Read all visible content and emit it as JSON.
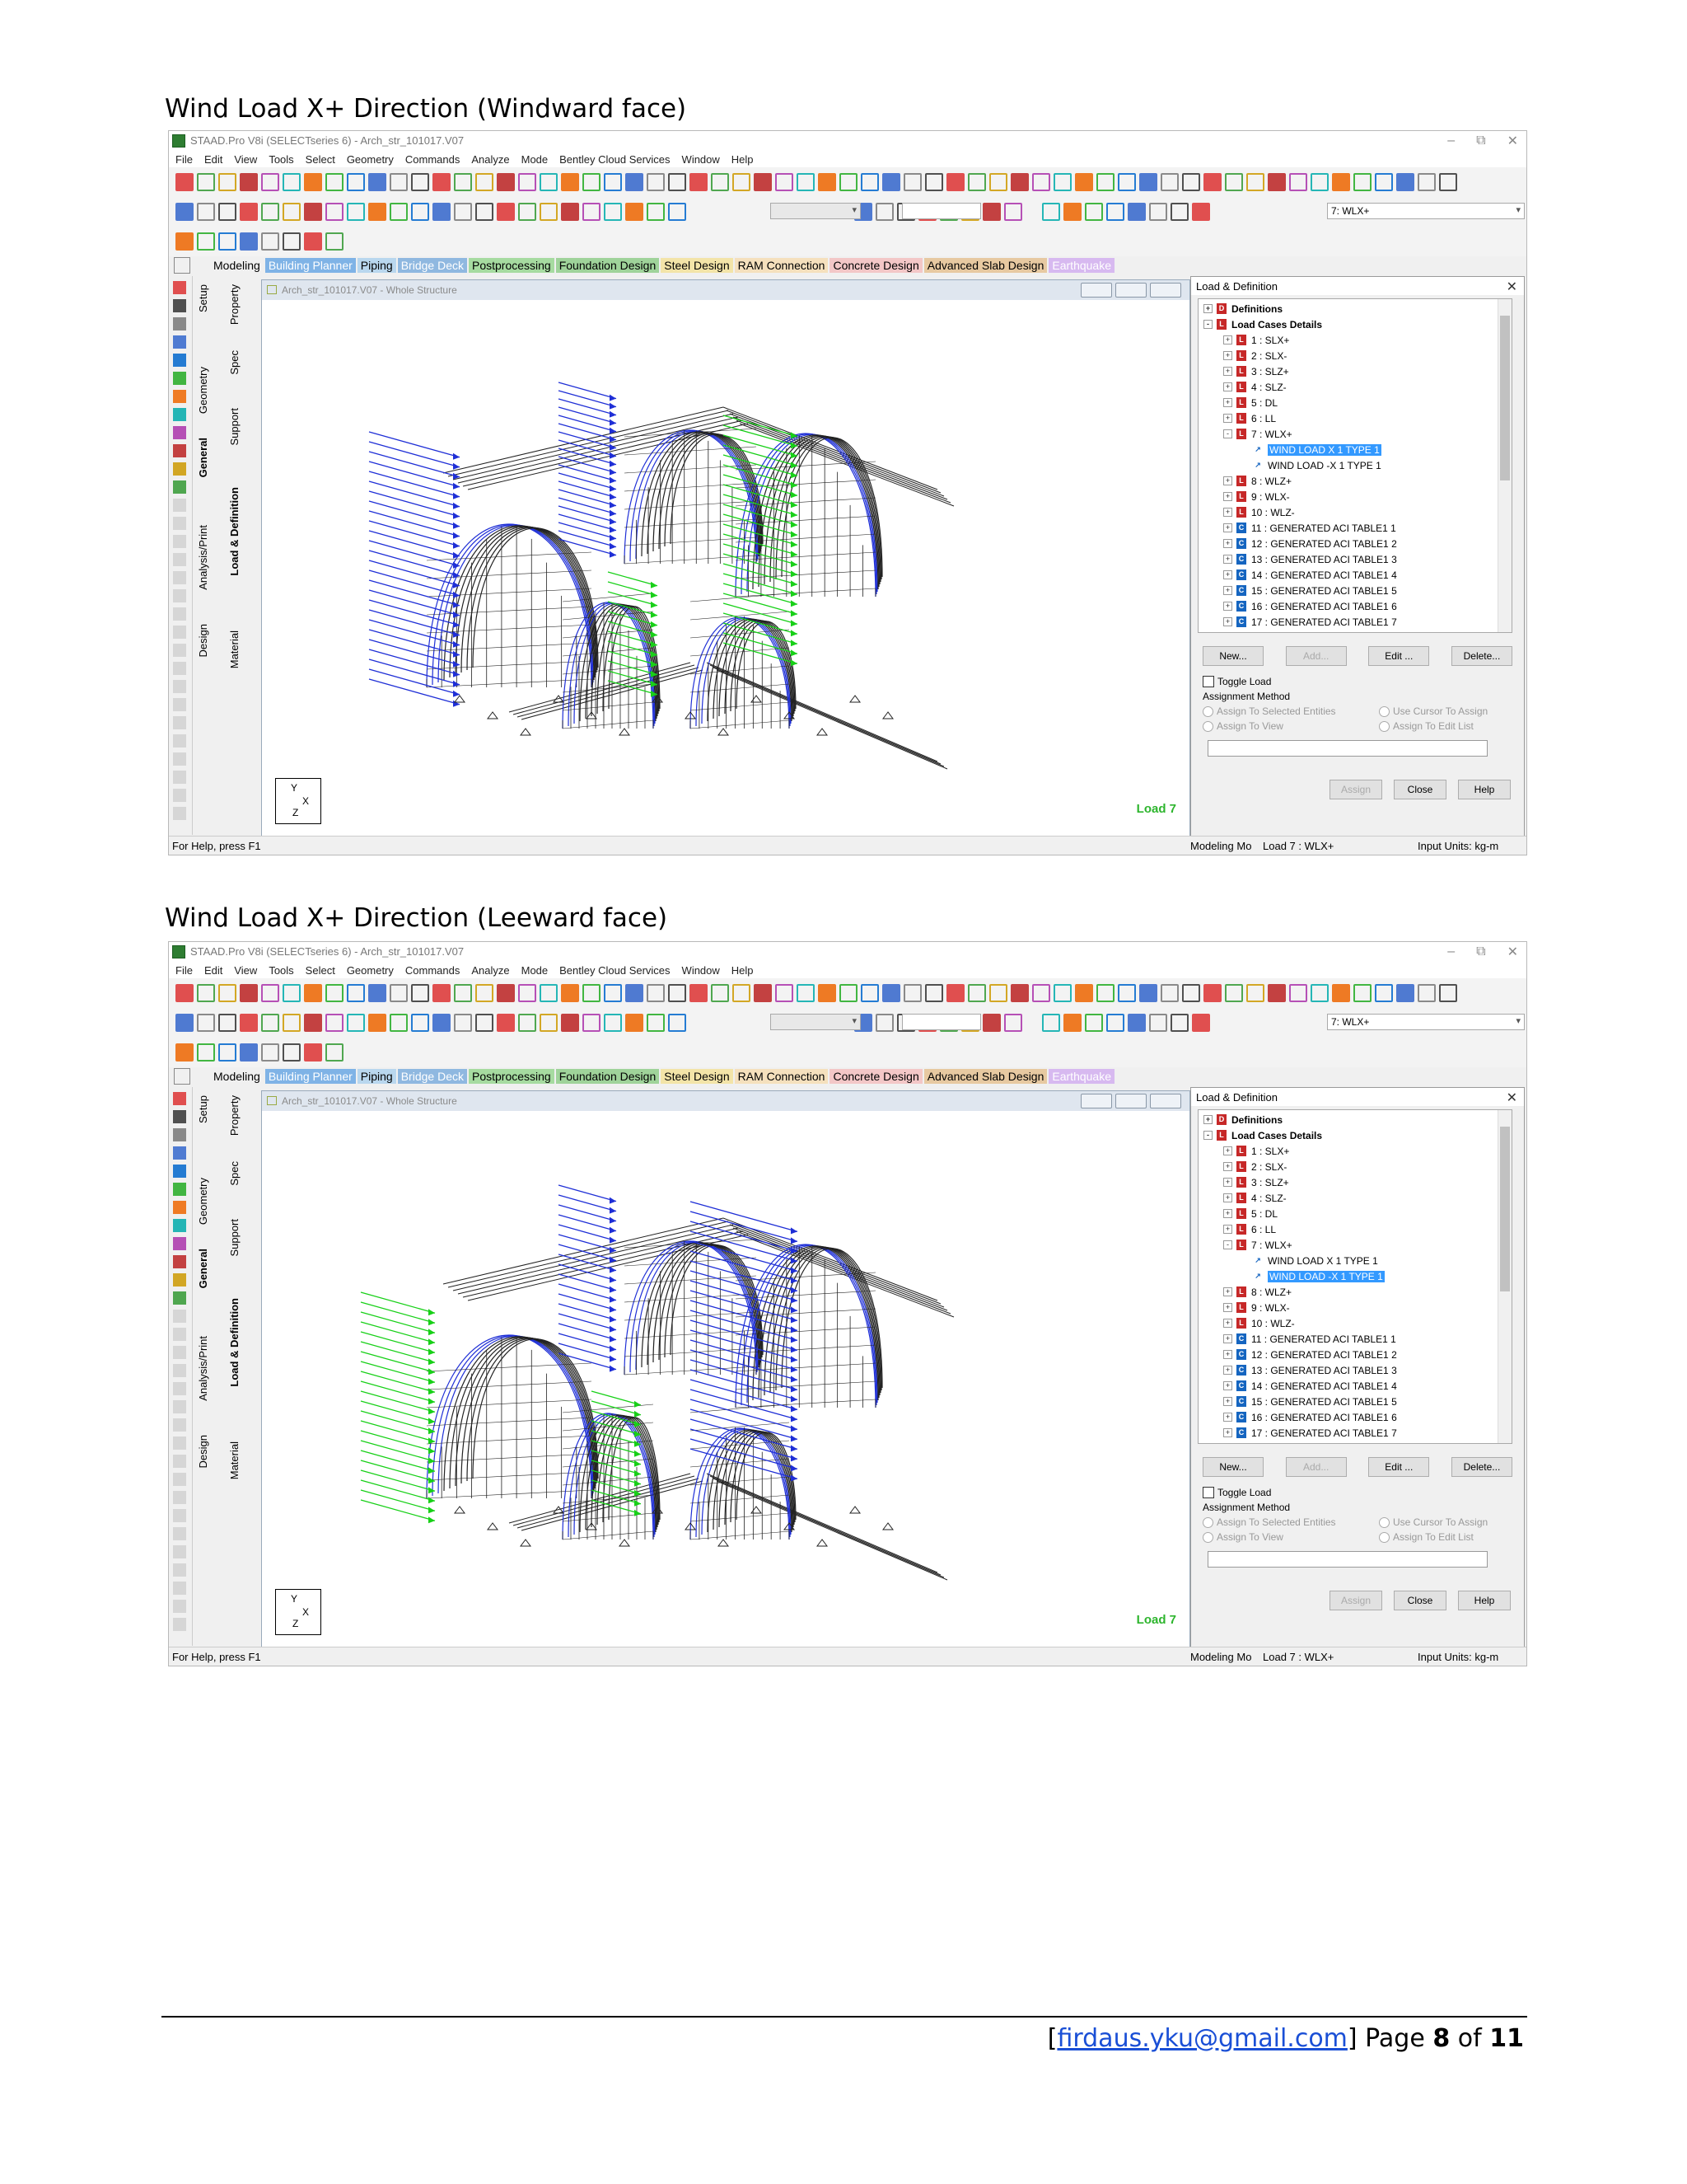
{
  "sections": [
    {
      "heading": "Wind Load X+ Direction (Windward face)",
      "app": {
        "title": "STAAD.Pro V8i (SELECTseries 6) - Arch_str_101017.V07",
        "menu": [
          "File",
          "Edit",
          "View",
          "Tools",
          "Select",
          "Geometry",
          "Commands",
          "Analyze",
          "Mode",
          "Bentley Cloud Services",
          "Window",
          "Help"
        ],
        "load_combo": "7: WLX+",
        "tabs": [
          {
            "label": "Modeling",
            "color": "#f0f0f0"
          },
          {
            "label": "Building Planner",
            "color": "#7fb3e6"
          },
          {
            "label": "Piping",
            "color": "#b9d7ee"
          },
          {
            "label": "Bridge Deck",
            "color": "#8fb8e0"
          },
          {
            "label": "Postprocessing",
            "color": "#a6dba0"
          },
          {
            "label": "Foundation Design",
            "color": "#9fd39a"
          },
          {
            "label": "Steel Design",
            "color": "#f3e4a8"
          },
          {
            "label": "RAM Connection",
            "color": "#f5e0bd"
          },
          {
            "label": "Concrete Design",
            "color": "#f3c7c7"
          },
          {
            "label": "Advanced Slab Design",
            "color": "#e7c9a1"
          },
          {
            "label": "Earthquake",
            "color": "#d7b9f0"
          }
        ],
        "vertical_tabs": {
          "setup": "Setup",
          "geometry": "Geometry",
          "general": "General",
          "analysis_print": "Analysis/Print",
          "design": "Design",
          "property": "Property",
          "spec": "Spec",
          "support": "Support",
          "load_definition": "Load & Definition",
          "material": "Material"
        },
        "document_title": "Arch_str_101017.V07 - Whole Structure",
        "load_label": "Load 7",
        "axis_labels": {
          "y": "Y",
          "x": "X",
          "z": "Z"
        },
        "panel": {
          "title": "Load & Definition",
          "tree": [
            {
              "text": "Definitions",
              "icon": "D",
              "bold": true,
              "level": 0,
              "exp": "+"
            },
            {
              "text": "Load Cases Details",
              "icon": "L",
              "bold": true,
              "level": 0,
              "exp": "-"
            },
            {
              "text": "1 : SLX+",
              "icon": "L",
              "level": 1,
              "exp": "+"
            },
            {
              "text": "2 : SLX-",
              "icon": "L",
              "level": 1,
              "exp": "+"
            },
            {
              "text": "3 : SLZ+",
              "icon": "L",
              "level": 1,
              "exp": "+"
            },
            {
              "text": "4 : SLZ-",
              "icon": "L",
              "level": 1,
              "exp": "+"
            },
            {
              "text": "5 : DL",
              "icon": "L",
              "level": 1,
              "exp": "+"
            },
            {
              "text": "6 : LL",
              "icon": "L",
              "level": 1,
              "exp": "+"
            },
            {
              "text": "7 : WLX+",
              "icon": "L",
              "level": 1,
              "exp": "-"
            },
            {
              "text": "WIND LOAD X 1 TYPE 1",
              "icon": "W",
              "level": 2,
              "selected": true
            },
            {
              "text": "WIND LOAD -X 1 TYPE 1",
              "icon": "W",
              "level": 2
            },
            {
              "text": "8 : WLZ+",
              "icon": "L",
              "level": 1,
              "exp": "+"
            },
            {
              "text": "9 : WLX-",
              "icon": "L",
              "level": 1,
              "exp": "+"
            },
            {
              "text": "10 : WLZ-",
              "icon": "L",
              "level": 1,
              "exp": "+"
            },
            {
              "text": "11 : GENERATED ACI TABLE1 1",
              "icon": "C",
              "level": 1,
              "exp": "+"
            },
            {
              "text": "12 : GENERATED ACI TABLE1 2",
              "icon": "C",
              "level": 1,
              "exp": "+"
            },
            {
              "text": "13 : GENERATED ACI TABLE1 3",
              "icon": "C",
              "level": 1,
              "exp": "+"
            },
            {
              "text": "14 : GENERATED ACI TABLE1 4",
              "icon": "C",
              "level": 1,
              "exp": "+"
            },
            {
              "text": "15 : GENERATED ACI TABLE1 5",
              "icon": "C",
              "level": 1,
              "exp": "+"
            },
            {
              "text": "16 : GENERATED ACI TABLE1 6",
              "icon": "C",
              "level": 1,
              "exp": "+"
            },
            {
              "text": "17 : GENERATED ACI TABLE1 7",
              "icon": "C",
              "level": 1,
              "exp": "+"
            }
          ],
          "buttons": {
            "new": "New...",
            "add": "Add...",
            "edit": "Edit ...",
            "delete": "Delete..."
          },
          "toggle_load": "Toggle Load",
          "assignment_method": "Assignment Method",
          "radios": {
            "selected_entities": "Assign To Selected Entities",
            "view": "Assign To View",
            "cursor": "Use Cursor To Assign",
            "edit_list": "Assign To Edit List"
          },
          "bottom_buttons": {
            "assign": "Assign",
            "close": "Close",
            "help": "Help"
          }
        },
        "status": {
          "help": "For Help, press F1",
          "mode": "Modeling Mo",
          "load": "Load 7 : WLX+",
          "units": "Input Units:  kg-m"
        }
      }
    },
    {
      "heading": "Wind Load X+ Direction (Leeward face)",
      "app": {
        "title": "STAAD.Pro V8i (SELECTseries 6) - Arch_str_101017.V07",
        "menu": [
          "File",
          "Edit",
          "View",
          "Tools",
          "Select",
          "Geometry",
          "Commands",
          "Analyze",
          "Mode",
          "Bentley Cloud Services",
          "Window",
          "Help"
        ],
        "load_combo": "7: WLX+",
        "tabs": [
          {
            "label": "Modeling",
            "color": "#f0f0f0"
          },
          {
            "label": "Building Planner",
            "color": "#7fb3e6"
          },
          {
            "label": "Piping",
            "color": "#b9d7ee"
          },
          {
            "label": "Bridge Deck",
            "color": "#8fb8e0"
          },
          {
            "label": "Postprocessing",
            "color": "#a6dba0"
          },
          {
            "label": "Foundation Design",
            "color": "#9fd39a"
          },
          {
            "label": "Steel Design",
            "color": "#f3e4a8"
          },
          {
            "label": "RAM Connection",
            "color": "#f5e0bd"
          },
          {
            "label": "Concrete Design",
            "color": "#f3c7c7"
          },
          {
            "label": "Advanced Slab Design",
            "color": "#e7c9a1"
          },
          {
            "label": "Earthquake",
            "color": "#d7b9f0"
          }
        ],
        "vertical_tabs": {
          "setup": "Setup",
          "geometry": "Geometry",
          "general": "General",
          "analysis_print": "Analysis/Print",
          "design": "Design",
          "property": "Property",
          "spec": "Spec",
          "support": "Support",
          "load_definition": "Load & Definition",
          "material": "Material"
        },
        "document_title": "Arch_str_101017.V07 - Whole Structure",
        "load_label": "Load 7",
        "axis_labels": {
          "y": "Y",
          "x": "X",
          "z": "Z"
        },
        "panel": {
          "title": "Load & Definition",
          "tree": [
            {
              "text": "Definitions",
              "icon": "D",
              "bold": true,
              "level": 0,
              "exp": "+"
            },
            {
              "text": "Load Cases Details",
              "icon": "L",
              "bold": true,
              "level": 0,
              "exp": "-"
            },
            {
              "text": "1 : SLX+",
              "icon": "L",
              "level": 1,
              "exp": "+"
            },
            {
              "text": "2 : SLX-",
              "icon": "L",
              "level": 1,
              "exp": "+"
            },
            {
              "text": "3 : SLZ+",
              "icon": "L",
              "level": 1,
              "exp": "+"
            },
            {
              "text": "4 : SLZ-",
              "icon": "L",
              "level": 1,
              "exp": "+"
            },
            {
              "text": "5 : DL",
              "icon": "L",
              "level": 1,
              "exp": "+"
            },
            {
              "text": "6 : LL",
              "icon": "L",
              "level": 1,
              "exp": "+"
            },
            {
              "text": "7 : WLX+",
              "icon": "L",
              "level": 1,
              "exp": "-"
            },
            {
              "text": "WIND LOAD X 1 TYPE 1",
              "icon": "W",
              "level": 2
            },
            {
              "text": "WIND LOAD -X 1 TYPE 1",
              "icon": "W",
              "level": 2,
              "selected": true
            },
            {
              "text": "8 : WLZ+",
              "icon": "L",
              "level": 1,
              "exp": "+"
            },
            {
              "text": "9 : WLX-",
              "icon": "L",
              "level": 1,
              "exp": "+"
            },
            {
              "text": "10 : WLZ-",
              "icon": "L",
              "level": 1,
              "exp": "+"
            },
            {
              "text": "11 : GENERATED ACI TABLE1 1",
              "icon": "C",
              "level": 1,
              "exp": "+"
            },
            {
              "text": "12 : GENERATED ACI TABLE1 2",
              "icon": "C",
              "level": 1,
              "exp": "+"
            },
            {
              "text": "13 : GENERATED ACI TABLE1 3",
              "icon": "C",
              "level": 1,
              "exp": "+"
            },
            {
              "text": "14 : GENERATED ACI TABLE1 4",
              "icon": "C",
              "level": 1,
              "exp": "+"
            },
            {
              "text": "15 : GENERATED ACI TABLE1 5",
              "icon": "C",
              "level": 1,
              "exp": "+"
            },
            {
              "text": "16 : GENERATED ACI TABLE1 6",
              "icon": "C",
              "level": 1,
              "exp": "+"
            },
            {
              "text": "17 : GENERATED ACI TABLE1 7",
              "icon": "C",
              "level": 1,
              "exp": "+"
            }
          ],
          "buttons": {
            "new": "New...",
            "add": "Add...",
            "edit": "Edit ...",
            "delete": "Delete..."
          },
          "toggle_load": "Toggle Load",
          "assignment_method": "Assignment Method",
          "radios": {
            "selected_entities": "Assign To Selected Entities",
            "view": "Assign To View",
            "cursor": "Use Cursor To Assign",
            "edit_list": "Assign To Edit List"
          },
          "bottom_buttons": {
            "assign": "Assign",
            "close": "Close",
            "help": "Help"
          }
        },
        "status": {
          "help": "For Help, press F1",
          "mode": "Modeling Mo",
          "load": "Load 7 : WLX+",
          "units": "Input Units:  kg-m"
        }
      }
    }
  ],
  "footer": {
    "open_bracket": "[",
    "email": "firdaus.yku@gmail.com",
    "close_bracket": "]",
    "page_word": "Page",
    "page": "8",
    "of_word": "of",
    "total": "11"
  },
  "colors": {
    "wind_blue": "#1f2fd6",
    "wind_green": "#18d018",
    "frame": "#222222",
    "selection": "#3399ff",
    "load_label": "#2db52d"
  }
}
